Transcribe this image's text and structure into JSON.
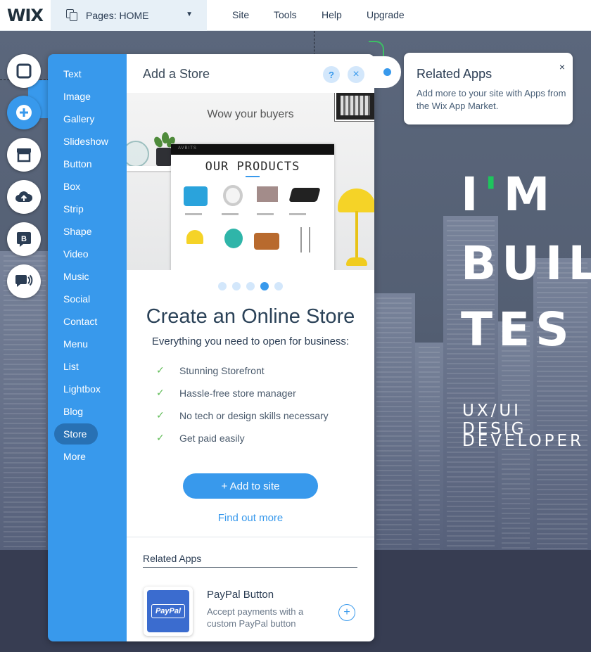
{
  "topbar": {
    "logo": "WIX",
    "pages_label": "Pages: HOME",
    "menu": [
      "Site",
      "Tools",
      "Help",
      "Upgrade"
    ]
  },
  "site": {
    "hero_line1": "I'M",
    "hero_line2": "BUIL",
    "hero_line3": "TES",
    "subtitle_line1": "UX/UI DESIG",
    "subtitle_line2": "DEVELOPER"
  },
  "tools": [
    "background-icon",
    "add-icon",
    "store-icon",
    "upload-icon",
    "blog-icon",
    "chat-icon"
  ],
  "categories": [
    "Text",
    "Image",
    "Gallery",
    "Slideshow",
    "Button",
    "Box",
    "Strip",
    "Shape",
    "Video",
    "Music",
    "Social",
    "Contact",
    "Menu",
    "List",
    "Lightbox",
    "Blog",
    "Store",
    "More"
  ],
  "active_category": "Store",
  "panel": {
    "title": "Add a Store",
    "help": "?",
    "close": "×",
    "image": {
      "tagline": "Wow your buyers",
      "mock_brand": "AVBITS",
      "mock_title": "OUR PRODUCTS"
    },
    "carousel": {
      "count": 5,
      "active_index": 3
    },
    "heading": "Create an Online Store",
    "subheading": "Everything you need to open for business:",
    "features": [
      "Stunning Storefront",
      "Hassle-free store manager",
      "No tech or design skills necessary",
      "Get paid easily"
    ],
    "add_button": "+ Add to site",
    "find_more": "Find out more",
    "related_label": "Related Apps",
    "app": {
      "name": "PayPal Button",
      "description": "Accept payments with a custom PayPal button",
      "logo_text": "PayPal",
      "add": "+"
    }
  },
  "tooltip": {
    "title": "Related Apps",
    "text": "Add more to your site with Apps from the Wix App Market.",
    "close": "×"
  },
  "colors": {
    "accent": "#3899ec",
    "panel_dark": "#2871b4",
    "check": "#60bc57",
    "site_green": "#1ec45d"
  }
}
